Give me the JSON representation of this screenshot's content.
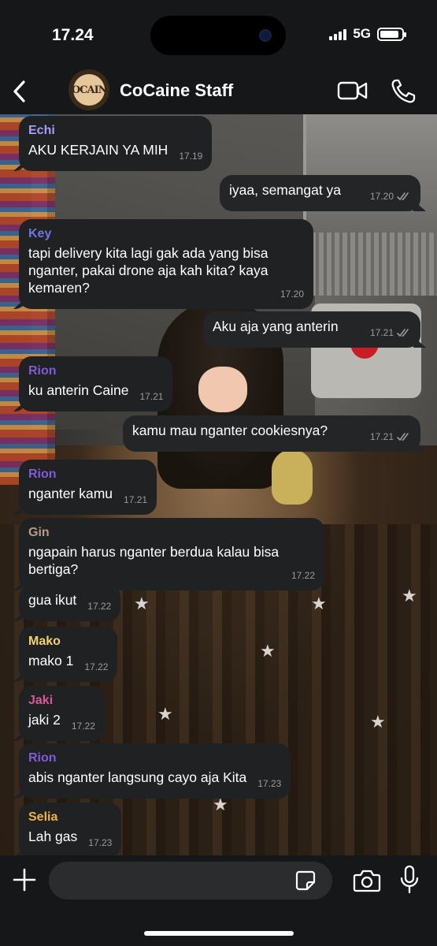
{
  "status": {
    "time": "17.24",
    "network": "5G",
    "battery_level": 0.9
  },
  "header": {
    "title": "CoCaine Staff",
    "avatar_text": "COCAINE"
  },
  "colors": {
    "echi": "#a99cf2",
    "key": "#6a78e6",
    "rion": "#7f5bd6",
    "gin": "#b59c8a",
    "mako": "#f5d36c",
    "jaki": "#d9579b",
    "selia": "#f0b43c"
  },
  "messages": [
    {
      "dir": "in",
      "sender": "Echi",
      "color_key": "echi",
      "text": "AKU KERJAIN YA MIH",
      "time": "17.19"
    },
    {
      "dir": "out",
      "text": "iyaa, semangat ya",
      "time": "17.20"
    },
    {
      "dir": "in",
      "sender": "Key",
      "color_key": "key",
      "text": "tapi delivery kita lagi gak ada yang bisa nganter, pakai drone aja kah kita? kaya kemaren?",
      "time": "17.20"
    },
    {
      "dir": "out",
      "text": "Aku aja yang anterin",
      "time": "17.21"
    },
    {
      "dir": "in",
      "sender": "Rion",
      "color_key": "rion",
      "text": "ku anterin Caine",
      "time": "17.21"
    },
    {
      "dir": "out",
      "text": "kamu mau nganter cookiesnya?",
      "time": "17.21"
    },
    {
      "dir": "in",
      "sender": "Rion",
      "color_key": "rion",
      "text": "nganter kamu",
      "time": "17.21"
    },
    {
      "dir": "in",
      "sender": "Gin",
      "color_key": "gin",
      "text": "ngapain harus nganter berdua kalau bisa bertiga?",
      "time": "17.22"
    },
    {
      "dir": "in",
      "sender": "",
      "color_key": "gin",
      "text": "gua ikut",
      "time": "17.22"
    },
    {
      "dir": "in",
      "sender": "Mako",
      "color_key": "mako",
      "text": "mako 1",
      "time": "17.22"
    },
    {
      "dir": "in",
      "sender": "Jaki",
      "color_key": "jaki",
      "text": "jaki 2",
      "time": "17.22"
    },
    {
      "dir": "in",
      "sender": "Rion",
      "color_key": "rion",
      "text": "abis nganter langsung cayo aja Kita",
      "time": "17.23"
    },
    {
      "dir": "in",
      "sender": "Selia",
      "color_key": "selia",
      "text": "Lah gas",
      "time": "17.23"
    }
  ],
  "input": {
    "placeholder": ""
  },
  "icons": {
    "back": "chevron-left-icon",
    "video": "video-camera-icon",
    "call": "phone-icon",
    "plus": "plus-icon",
    "sticker": "sticker-icon",
    "camera": "camera-icon",
    "mic": "microphone-icon",
    "read": "double-check-icon"
  }
}
